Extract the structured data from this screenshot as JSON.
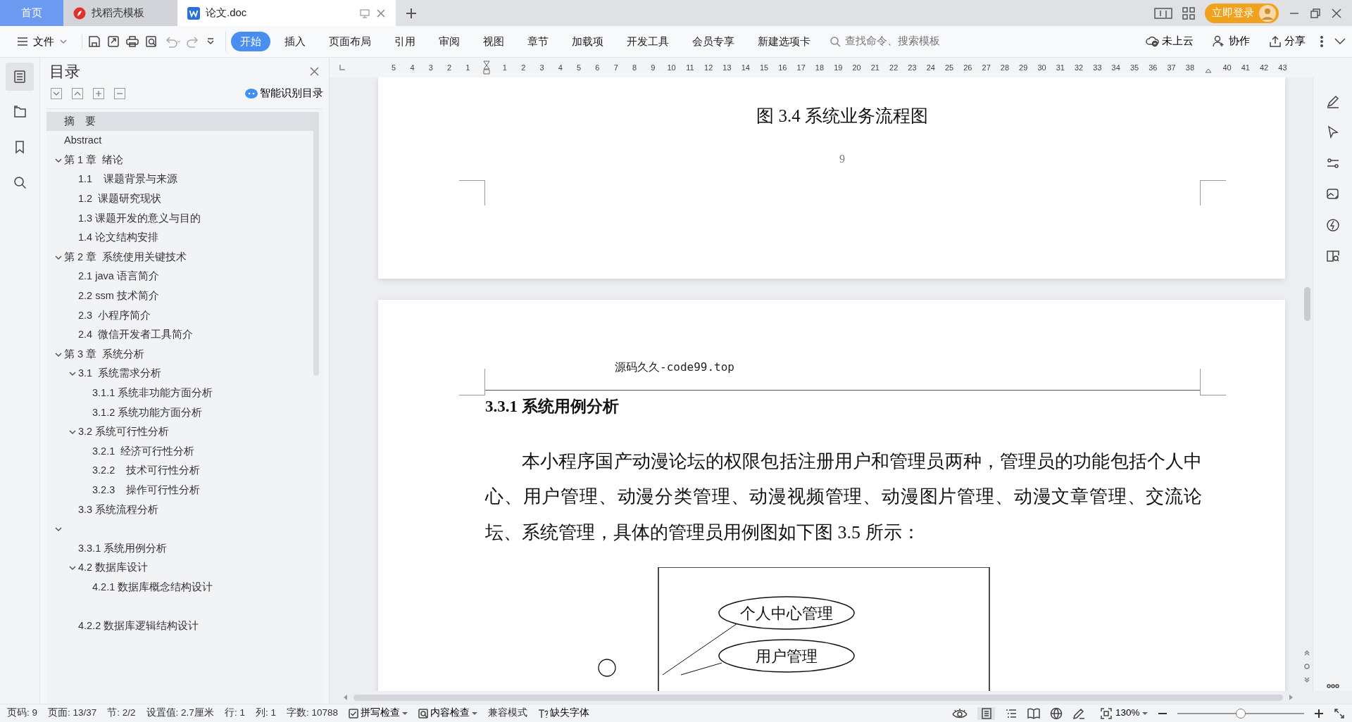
{
  "title_bar": {
    "tabs": [
      {
        "label": "首页",
        "kind": "home",
        "selected": false
      },
      {
        "label": "找稻壳模板",
        "kind": "template",
        "selected": false
      },
      {
        "label": "论文.doc",
        "kind": "document",
        "selected": true
      }
    ],
    "login_button": "立即登录"
  },
  "toolbar": {
    "file_menu": "文件",
    "ribbon_tabs": [
      {
        "label": "开始",
        "selected": true
      },
      {
        "label": "插入",
        "selected": false
      },
      {
        "label": "页面布局",
        "selected": false
      },
      {
        "label": "引用",
        "selected": false
      },
      {
        "label": "审阅",
        "selected": false
      },
      {
        "label": "视图",
        "selected": false
      },
      {
        "label": "章节",
        "selected": false
      },
      {
        "label": "加载项",
        "selected": false
      },
      {
        "label": "开发工具",
        "selected": false
      },
      {
        "label": "会员专享",
        "selected": false
      },
      {
        "label": "新建选项卡",
        "selected": false
      }
    ],
    "search": {
      "placeholder": "查找命令、搜索模板"
    },
    "actions": [
      {
        "label": "未上云",
        "kind": "cloud"
      },
      {
        "label": "协作",
        "kind": "collab"
      },
      {
        "label": "分享",
        "kind": "share"
      }
    ]
  },
  "navigation_pane": {
    "title": "目录",
    "smart_button": "智能识别目录",
    "items": [
      {
        "title": "摘　要",
        "selected": true
      },
      {
        "title": "Abstract",
        "selected": false
      },
      {
        "title": "第 1 章  绪论",
        "selected": false,
        "expanded": true,
        "children": [
          {
            "title": "1.1    课题背景与来源",
            "selected": false
          },
          {
            "title": "1.2  课题研究现状",
            "selected": false
          },
          {
            "title": "1.3 课题开发的意义与目的",
            "selected": false
          },
          {
            "title": "1.4 论文结构安排",
            "selected": false
          }
        ]
      },
      {
        "title": "第 2 章  系统使用关键技术",
        "selected": false,
        "expanded": true,
        "children": [
          {
            "title": "2.1 java 语言简介",
            "selected": false
          },
          {
            "title": "2.2 ssm 技术简介",
            "selected": false
          },
          {
            "title": "2.3  小程序简介",
            "selected": false
          },
          {
            "title": "2.4  微信开发者工具简介",
            "selected": false
          }
        ]
      },
      {
        "title": "第 3 章  系统分析",
        "selected": false,
        "expanded": true,
        "children": [
          {
            "title": "3.1  系统需求分析",
            "selected": false,
            "expanded": true,
            "children": [
              {
                "title": "3.1.1 系统非功能方面分析",
                "selected": false
              },
              {
                "title": "3.1.2 系统功能方面分析",
                "selected": false
              }
            ]
          },
          {
            "title": "3.2 系统可行性分析",
            "selected": false,
            "expanded": true,
            "children": [
              {
                "title": "3.2.1  经济可行性分析",
                "selected": false
              },
              {
                "title": "3.2.2    技术可行性分析",
                "selected": false
              },
              {
                "title": "3.2.3    操作可行性分析",
                "selected": false
              }
            ]
          },
          {
            "title": "3.3 系统流程分析",
            "selected": false
          }
        ]
      },
      {
        "selected": false,
        "expanded": true,
        "children": [
          {
            "title": "3.3.1 系统用例分析",
            "selected": false
          },
          {
            "title": "4.2 数据库设计",
            "selected": false,
            "expanded": true,
            "children": [
              {
                "title": "4.2.1 数据库概念结构设计",
                "selected": false
              }
            ]
          },
          {
            "selected": false
          },
          {
            "title": "4.2.2 数据库逻辑结构设计",
            "selected": false
          }
        ]
      }
    ]
  },
  "ruler": {
    "left_ticks": [
      "5",
      "4",
      "3",
      "2",
      "1"
    ],
    "right_ticks": [
      "1",
      "2",
      "3",
      "4",
      "5",
      "6",
      "7",
      "8",
      "9",
      "10",
      "11",
      "12",
      "13",
      "14",
      "15",
      "16",
      "17",
      "18",
      "19",
      "20",
      "21",
      "22",
      "23",
      "24",
      "25",
      "26",
      "27",
      "28",
      "29",
      "30",
      "31",
      "32",
      "33",
      "34",
      "35",
      "36",
      "37",
      "38"
    ],
    "outer_ticks": [
      "40",
      "41",
      "42",
      "43"
    ]
  },
  "document": {
    "pages": [
      {
        "kind": "page_end",
        "caption": "图 3.4 系统业务流程图",
        "page_number": "9"
      },
      {
        "kind": "page_start",
        "header": "源码久久-code99.top",
        "heading": "3.3.1 系统用例分析",
        "paragraph": "本小程序国产动漫论坛的权限包括注册用户和管理员两种，管理员的功能包括个人中心、用户管理、动漫分类管理、动漫视频管理、动漫图片管理、动漫文章管理、交流论坛、系统管理，具体的管理员用例图如下图 3.5 所示：",
        "diagram": {
          "use_cases": [
            "个人中心管理",
            "用户管理"
          ]
        }
      }
    ]
  },
  "status_bar": {
    "items": [
      {
        "text": "页码: 9",
        "kind": "info"
      },
      {
        "text": "页面: 13/37",
        "kind": "info"
      },
      {
        "text": "节: 2/2",
        "kind": "info"
      },
      {
        "text": "设置值: 2.7厘米",
        "kind": "info"
      },
      {
        "text": "行: 1",
        "kind": "info"
      },
      {
        "text": "列: 1",
        "kind": "info"
      },
      {
        "text": "字数: 10788",
        "kind": "info"
      },
      {
        "text": "拼写检查",
        "kind": "spell_check"
      },
      {
        "text": "内容检查",
        "kind": "content_check"
      },
      {
        "text": "兼容模式",
        "kind": "info"
      },
      {
        "text": "缺失字体",
        "kind": "missing_font"
      }
    ],
    "zoom": {
      "reading": "130%",
      "level": 0.5
    }
  }
}
